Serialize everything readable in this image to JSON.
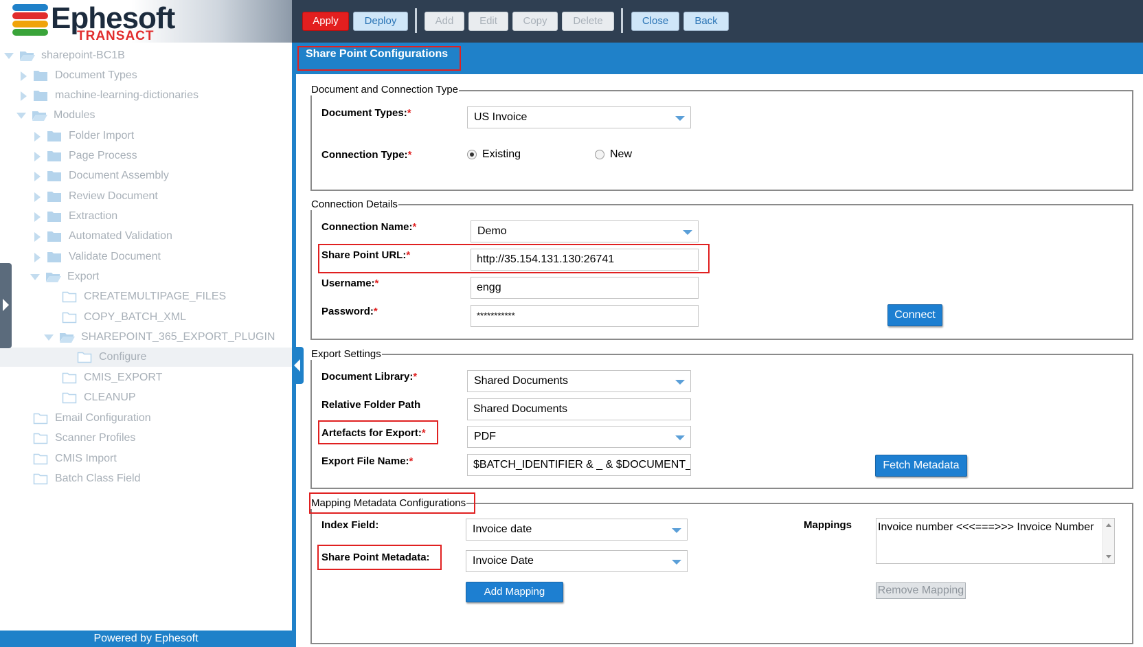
{
  "logo": {
    "name": "Ephesoft",
    "sub": "TRANSACT",
    "bar_colors": [
      "#1f81c9",
      "#e12d2d",
      "#f0a30a",
      "#3aa43a"
    ]
  },
  "toolbar": {
    "apply": "Apply",
    "deploy": "Deploy",
    "add": "Add",
    "edit": "Edit",
    "copy": "Copy",
    "delete": "Delete",
    "close": "Close",
    "back": "Back"
  },
  "tree": {
    "root": "sharepoint-BC1B",
    "document_types": "Document Types",
    "ml_dictionaries": "machine-learning-dictionaries",
    "modules": "Modules",
    "folder_import": "Folder Import",
    "page_process": "Page Process",
    "document_assembly": "Document Assembly",
    "review_document": "Review Document",
    "extraction": "Extraction",
    "automated_validation": "Automated Validation",
    "validate_document": "Validate Document",
    "export": "Export",
    "createmultipage": "CREATEMULTIPAGE_FILES",
    "copy_batch_xml": "COPY_BATCH_XML",
    "sharepoint_plugin": "SHAREPOINT_365_EXPORT_PLUGIN",
    "configure": "Configure",
    "cmis_export": "CMIS_EXPORT",
    "cleanup": "CLEANUP",
    "email_configuration": "Email Configuration",
    "scanner_profiles": "Scanner Profiles",
    "cmis_import": "CMIS Import",
    "batch_class_field": "Batch Class Field"
  },
  "footer": {
    "powered": "Powered by Ephesoft"
  },
  "main": {
    "title": "Share Point Configurations",
    "doc_conn": {
      "legend": "Document and Connection Type",
      "doc_types_label": "Document Types:",
      "doc_types_value": "US Invoice",
      "conn_type_label": "Connection Type:",
      "existing": "Existing",
      "new": "New"
    },
    "conn_details": {
      "legend": "Connection Details",
      "name_label": "Connection Name:",
      "name_value": "Demo",
      "url_label": "Share Point URL:",
      "url_value": "http://35.154.131.130:26741",
      "user_label": "Username:",
      "user_value": "engg",
      "pass_label": "Password:",
      "pass_value": "***********",
      "connect": "Connect"
    },
    "export": {
      "legend": "Export Settings",
      "lib_label": "Document Library:",
      "lib_value": "Shared Documents",
      "path_label": "Relative Folder Path",
      "path_value": "Shared Documents",
      "art_label": "Artefacts for Export:",
      "art_value": "PDF",
      "file_label": "Export File Name:",
      "file_value": "$BATCH_IDENTIFIER & _ & $DOCUMENT_ID",
      "fetch": "Fetch Metadata"
    },
    "mapping": {
      "legend": "Mapping Metadata Configurations",
      "index_label": "Index Field:",
      "index_value": "Invoice date",
      "sp_meta_label": "Share Point Metadata:",
      "sp_meta_value": "Invoice Date",
      "add": "Add Mapping",
      "mappings_label": "Mappings",
      "mappings_value": "Invoice number <<<===>>> Invoice Number",
      "remove": "Remove Mapping"
    },
    "required_mark": "*"
  }
}
